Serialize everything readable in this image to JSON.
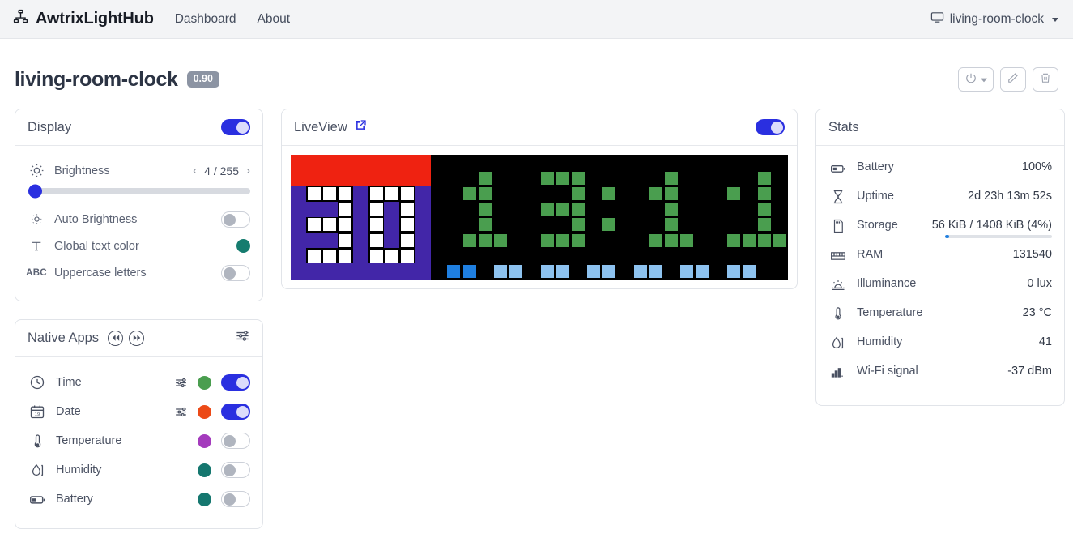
{
  "navbar": {
    "brand": "AwtrixLightHub",
    "brand_icon": "sitemap-icon",
    "links": [
      {
        "label": "Dashboard",
        "name": "nav-link-dashboard"
      },
      {
        "label": "About",
        "name": "nav-link-about"
      }
    ],
    "device_selector": {
      "label": "living-room-clock",
      "icon": "monitor-icon"
    }
  },
  "page": {
    "title": "living-room-clock",
    "version": "0.90",
    "actions": [
      {
        "name": "power-button",
        "icon": "power-icon"
      },
      {
        "name": "edit-button",
        "icon": "pencil-icon"
      },
      {
        "name": "delete-button",
        "icon": "trash-icon"
      }
    ]
  },
  "display": {
    "title": "Display",
    "enabled": true,
    "brightness": {
      "label": "Brightness",
      "icon": "sun-rays-icon",
      "value_text": "4 / 255",
      "value": 4,
      "max": 255,
      "percent": 1.6
    },
    "auto_brightness": {
      "label": "Auto Brightness",
      "icon": "sun-small-icon",
      "enabled": false
    },
    "global_text_color": {
      "label": "Global text color",
      "icon": "text-t-icon",
      "color": "#167c6f"
    },
    "uppercase_letters": {
      "label": "Uppercase letters",
      "icon": "abc-icon",
      "enabled": false
    }
  },
  "native_apps": {
    "title": "Native Apps",
    "prev_icon": "rewind-icon",
    "next_icon": "fast-forward-icon",
    "settings_icon": "sliders-icon",
    "apps": [
      {
        "label": "Time",
        "icon": "clock-icon",
        "color": "#4a9e4f",
        "enabled": true,
        "has_settings": true
      },
      {
        "label": "Date",
        "icon": "calendar-icon",
        "color": "#ec4a17",
        "enabled": true,
        "has_settings": true
      },
      {
        "label": "Temperature",
        "icon": "thermometer-icon",
        "color": "#a43bbd",
        "enabled": false,
        "has_settings": false
      },
      {
        "label": "Humidity",
        "icon": "humidity-icon",
        "color": "#15776f",
        "enabled": false,
        "has_settings": false
      },
      {
        "label": "Battery",
        "icon": "battery-icon",
        "color": "#15776f",
        "enabled": false,
        "has_settings": false
      }
    ]
  },
  "liveview": {
    "title": "LiveView",
    "external_icon": "external-link-icon",
    "enabled": true,
    "matrix": {
      "cols": 32,
      "rows": 8,
      "background": "#000000",
      "colors": {
        "red": "#ef2211",
        "indigo": "#4226a8",
        "white": "#ffffff",
        "green": "#4a9e4f",
        "blue_dark": "#1f7fe0",
        "blue_light": "#8dc2ef"
      },
      "display_text": "13:11",
      "description": "32x8 LED matrix: red banner rows, white/indigo checker icon at left, green clock digits 13:11, blue progress row at bottom"
    }
  },
  "stats": {
    "title": "Stats",
    "rows": [
      {
        "label": "Battery",
        "icon": "battery-icon",
        "value": "100%"
      },
      {
        "label": "Uptime",
        "icon": "hourglass-icon",
        "value": "2d 23h 13m 52s"
      },
      {
        "label": "Storage",
        "icon": "sd-card-icon",
        "value": "56 KiB / 1408 KiB (4%)",
        "bar_percent": 4
      },
      {
        "label": "RAM",
        "icon": "ram-icon",
        "value": "131540"
      },
      {
        "label": "Illuminance",
        "icon": "illuminance-icon",
        "value": "0 lux"
      },
      {
        "label": "Temperature",
        "icon": "thermometer-icon",
        "value": "23 °C"
      },
      {
        "label": "Humidity",
        "icon": "humidity-icon",
        "value": "41"
      },
      {
        "label": "Wi-Fi signal",
        "icon": "wifi-bars-icon",
        "value": "-37 dBm"
      }
    ]
  }
}
